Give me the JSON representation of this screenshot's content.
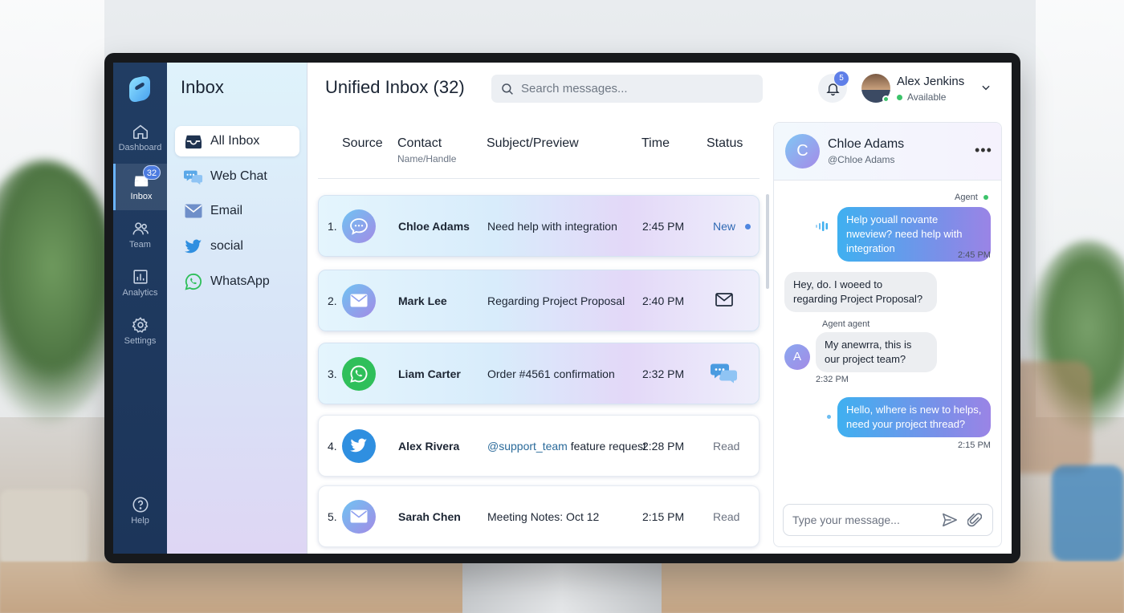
{
  "rail": {
    "items": [
      {
        "label": "Dashboard"
      },
      {
        "label": "Inbox",
        "badge": "32"
      },
      {
        "label": "Team"
      },
      {
        "label": "Analytics"
      },
      {
        "label": "Settings"
      }
    ],
    "help": "Help"
  },
  "folders": {
    "title": "Inbox",
    "items": [
      {
        "label": "All Inbox",
        "icon": "inbox-tray-icon"
      },
      {
        "label": "Web Chat",
        "icon": "chat-bubbles-icon"
      },
      {
        "label": "Email",
        "icon": "envelope-icon"
      },
      {
        "label": "social",
        "icon": "twitter-bird-icon"
      },
      {
        "label": "WhatsApp",
        "icon": "whatsapp-icon"
      }
    ]
  },
  "header": {
    "title": "Unified Inbox (32)",
    "search_placeholder": "Search messages...",
    "notifications": "5",
    "user_name": "Alex Jenkins",
    "user_status": "Available"
  },
  "table": {
    "columns": {
      "source": "Source",
      "contact": "Contact",
      "contact_sub": "Name/Handle",
      "subject": "Subject/Preview",
      "time": "Time",
      "status": "Status"
    },
    "rows": [
      {
        "num": "1.",
        "source": "web-chat",
        "contact": "Chloe Adams",
        "subject": "Need help with integration",
        "mention": "",
        "time": "2:45 PM",
        "status": "New"
      },
      {
        "num": "2.",
        "source": "email",
        "contact": "Mark Lee",
        "subject": "Regarding Project Proposal",
        "mention": "",
        "time": "2:40 PM",
        "status": "envelope-icon"
      },
      {
        "num": "3.",
        "source": "whatsapp",
        "contact": "Liam Carter",
        "subject": "Order #4561 confirmation",
        "mention": "",
        "time": "2:32 PM",
        "status": "chat-bubbles-icon"
      },
      {
        "num": "4.",
        "source": "twitter",
        "contact": "Alex Rivera",
        "mention": "@support_team",
        "subject": " feature request",
        "time": "2:28 PM",
        "status": "Read"
      },
      {
        "num": "5.",
        "source": "email",
        "contact": "Sarah Chen",
        "subject": "Meeting Notes: Oct 12",
        "mention": "",
        "time": "2:15 PM",
        "status": "Read"
      }
    ]
  },
  "chat": {
    "avatar_letter": "C",
    "name": "Chloe Adams",
    "handle": "@Chloe Adams",
    "messages": [
      {
        "sender_label": "Agent",
        "text": "Help youall novante nweview? need help with integration",
        "time": "2:45 PM"
      },
      {
        "sender_label": "",
        "text": "Hey, do. I woeed to regarding Project Proposal?",
        "time": ""
      },
      {
        "sender_label": "Agent agent",
        "avatar": "A",
        "text": "My anewrra, this is our project team?",
        "time": "2:32 PM"
      },
      {
        "sender_label": "",
        "text": "Hello, wlhere is new to helps, need your project thread?",
        "time": "2:15 PM"
      }
    ],
    "composer_placeholder": "Type your message..."
  },
  "colors": {
    "rail": "#213d63",
    "accent": "#4f86e0",
    "online": "#3cc36a",
    "bubble_out_start": "#3fb0f0",
    "bubble_out_end": "#9a84e6"
  }
}
